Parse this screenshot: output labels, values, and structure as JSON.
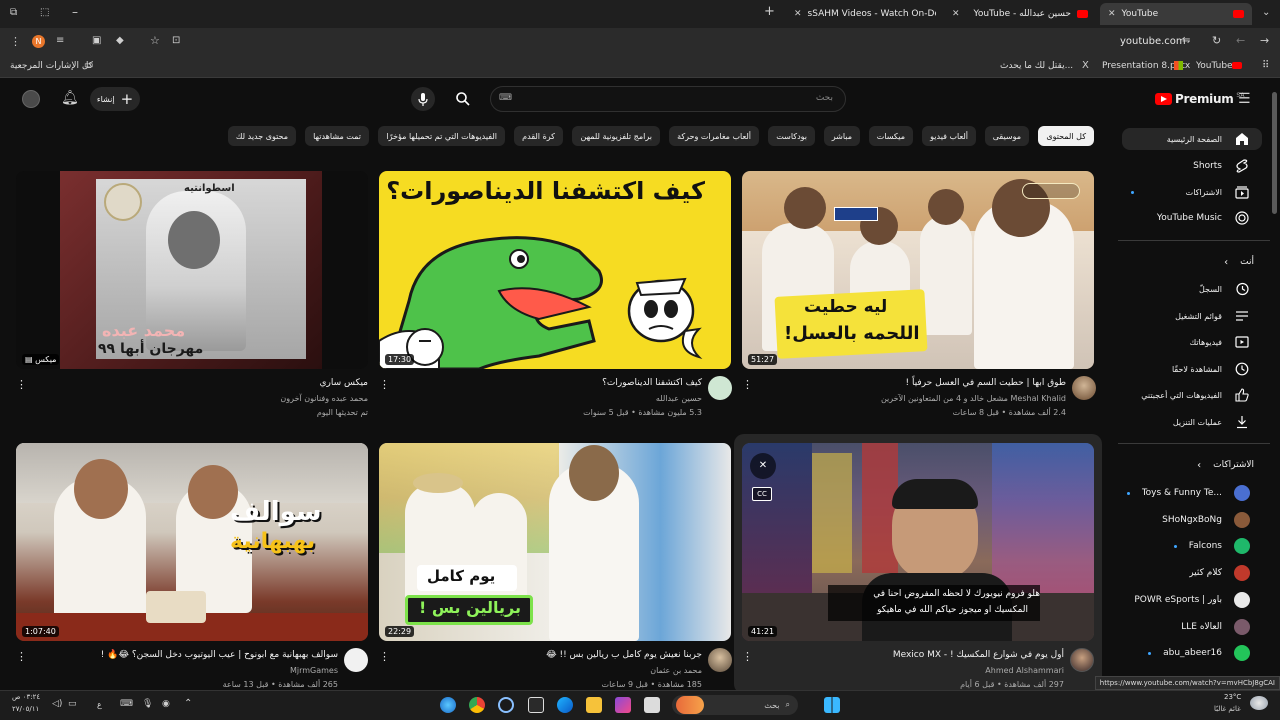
{
  "browser": {
    "tabs": [
      {
        "label": "sSAHM Videos - Watch On-De"
      },
      {
        "label": "YouTube - حسين عبدالله"
      },
      {
        "label": "YouTube"
      }
    ],
    "url": "youtube.com",
    "bookmarks": {
      "folder": "كل الإشارات المرجعية",
      "items": [
        "يقتل لك ما يحدث...",
        "Presentation 8.pptx",
        "YouTube"
      ]
    },
    "status_url": "https://www.youtube.com/watch?v=mvHCbJ8gCAI"
  },
  "header": {
    "logo": "Premium",
    "logo_sup": "SA",
    "create_label": "إنشاء",
    "search_placeholder": "بحث",
    "keyboard_label": "⌨"
  },
  "chips": [
    "كل المحتوى",
    "موسيقى",
    "ألعاب فيديو",
    "ميكسات",
    "مباشر",
    "بودكاست",
    "ألعاب مغامرات وحركة",
    "برامج تلفزيونية للمهن",
    "كرة القدم",
    "الفيديوهات التي تم تحميلها مؤخرًا",
    "تمت مشاهدتها",
    "محتوى جديد لك"
  ],
  "sidebar": {
    "main": [
      {
        "label": "الصفحة الرئيسية",
        "icon": "home-icon"
      },
      {
        "label": "Shorts",
        "icon": "shorts-icon"
      },
      {
        "label": "الاشتراكات",
        "icon": "subscriptions-icon"
      },
      {
        "label": "YouTube Music",
        "icon": "music-icon"
      }
    ],
    "you_heading": "أنت",
    "you": [
      {
        "label": "السجلّ",
        "icon": "history-icon"
      },
      {
        "label": "قوائم التشغيل",
        "icon": "playlist-icon"
      },
      {
        "label": "فيديوهاتك",
        "icon": "your-videos-icon"
      },
      {
        "label": "المشاهدة لاحقًا",
        "icon": "watch-later-icon"
      },
      {
        "label": "الفيديوهات التي أعجبتني",
        "icon": "like-icon"
      },
      {
        "label": "عمليات التنزيل",
        "icon": "download-icon"
      }
    ],
    "subs_heading": "الاشتراكات",
    "subs": [
      {
        "label": "Toys & Funny Te...",
        "color": "#4a6fd1"
      },
      {
        "label": "SHoNgxBoNg",
        "color": "#8a5a3a"
      },
      {
        "label": "Falcons",
        "color": "#1fb86a"
      },
      {
        "label": "كلام كثير",
        "color": "#c0392b"
      },
      {
        "label": "POWR eSports | باور",
        "color": "#e8e8e8"
      },
      {
        "label": "LLE العالاه",
        "color": "#7a5a6a"
      },
      {
        "label": "abu_abeer16",
        "color": "#23c45a"
      }
    ]
  },
  "videos": [
    {
      "title": "طوق ابها | حطيت السم في العسل حرفياً !",
      "channel": "Meshal Khalid مشعل خالد و 4 من المتعاونين الآخرين",
      "meta": "2.4 ألف مشاهدة • قبل 8 ساعات",
      "duration": "51:27",
      "thumb_text_1": "ليه حطيت",
      "thumb_text_2": "اللحمه بالعسل!"
    },
    {
      "title": "كيف اكتشفنا الديناصورات؟",
      "channel": "حسين عبدالله",
      "meta": "5.3 مليون مشاهدة • قبل 5 سنوات",
      "duration": "17:30",
      "thumb_text_1": "كيف اكتشفنا الديناصورات؟",
      "thumb_text_2": ""
    },
    {
      "title": "ميكس ساري",
      "channel": "محمد عبده وفنانون آخرون",
      "meta": "تم تحديثها اليوم",
      "duration": "ميكس",
      "thumb_text_1": "مهرجان أبها ٩٩",
      "thumb_text_2": "محمد عبده"
    },
    {
      "title": "أول يوم في شوارع المكسيك ! - Mexico MX",
      "channel": "Ahmed Alshammari",
      "meta": "297 ألف مشاهدة • قبل 6 أيام",
      "duration": "41:21",
      "thumb_text_1": "هلو فروم نيويورك لا لحظه المفروض احنا في",
      "thumb_text_2": "المكسيك او ميجوز حياكم الله في ماهيكو"
    },
    {
      "title": "جربنا نعيش يوم كامل ب ريالين بس !! 😂",
      "channel": "محمد بن عثمان",
      "meta": "185 مشاهدة • قبل 9 ساعات",
      "duration": "22:29",
      "thumb_text_1": "يوم كامل",
      "thumb_text_2": "بريالين بس !"
    },
    {
      "title": "سوالف بهبهانية مع ابونوح | عيب اليوتيوب دخل السجن؟ 😂🔥 !",
      "channel": "MjrmGames",
      "meta": "265 ألف مشاهدة • قبل 13 ساعة",
      "duration": "1:07:40",
      "thumb_text_1": "سوالف",
      "thumb_text_2": "بهبهانية"
    }
  ],
  "taskbar": {
    "search_label": "بحث",
    "time": "٠٣:٢٤ ص",
    "date": "٢٧/٠٥/١١",
    "weather_temp": "23°C",
    "weather_label": "غائم غالبًا",
    "lang": "ع"
  }
}
